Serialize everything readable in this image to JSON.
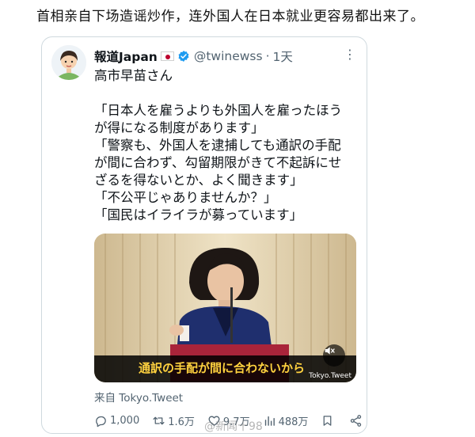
{
  "post": {
    "headline": "首相亲自下场造谣炒作，连外国人在日本就业更容易都出来了。"
  },
  "tweet": {
    "display_name": "報道Japan",
    "handle": "@twinewss",
    "separator": "·",
    "time": "1天",
    "lines_top": [
      "高市早苗さん"
    ],
    "lines": [
      "「日本人を雇うよりも外国人を雇ったほう",
      "が得になる制度があります」",
      "「警察も、外国人を逮捕しても通訳の手配",
      "が間に合わず、勾留期限がきて不起訴にせ",
      "ざるを得ないとか、よく聞きます」",
      "「不公平じゃありませんか？」",
      "「国民はイライラが募っています」"
    ],
    "video_subtitle": "通訳の手配が間に合わないから",
    "video_source_tag": "Tokyo.Tweet",
    "source": "来自 Tokyo.Tweet",
    "actions": {
      "replies": "1,000",
      "retweets": "1.6万",
      "likes": "9.7万",
      "views": "488万"
    }
  },
  "watermark": "@新闻十98",
  "colors": {
    "verified": "#1d9bf0",
    "subtitle": "#ffd23f",
    "meta": "#536471"
  }
}
